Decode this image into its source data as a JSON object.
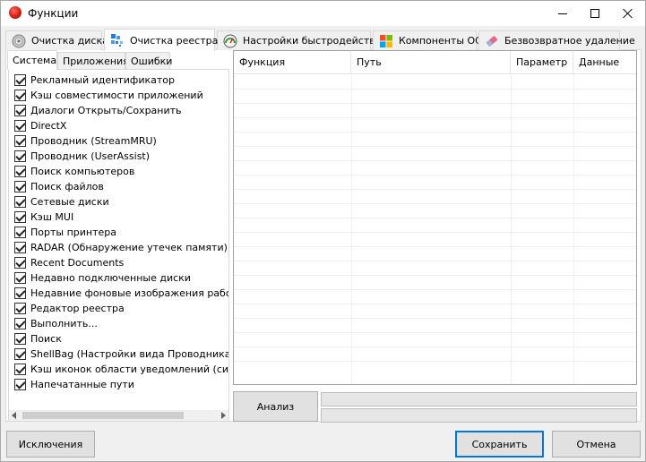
{
  "window": {
    "title": "Функции"
  },
  "tabs": [
    {
      "label": "Очистка диска",
      "icon": "disk-cleanup-icon"
    },
    {
      "label": "Очистка реестра",
      "icon": "registry-cleanup-icon",
      "active": true
    },
    {
      "label": "Настройки быстродействия",
      "icon": "speedometer-icon"
    },
    {
      "label": "Компоненты ОС",
      "icon": "windows-logo-icon"
    },
    {
      "label": "Безвозвратное удаление",
      "icon": "eraser-icon"
    }
  ],
  "subtabs": [
    {
      "label": "Система",
      "active": true
    },
    {
      "label": "Приложения"
    },
    {
      "label": "Ошибки"
    }
  ],
  "checklist": [
    {
      "label": "Рекламный идентификатор",
      "checked": true
    },
    {
      "label": "Кэш совместимости приложений",
      "checked": true
    },
    {
      "label": "Диалоги Открыть/Сохранить",
      "checked": true
    },
    {
      "label": "DirectX",
      "checked": true
    },
    {
      "label": "Проводник (StreamMRU)",
      "checked": true
    },
    {
      "label": "Проводник (UserAssist)",
      "checked": true
    },
    {
      "label": "Поиск компьютеров",
      "checked": true
    },
    {
      "label": "Поиск файлов",
      "checked": true
    },
    {
      "label": "Сетевые диски",
      "checked": true
    },
    {
      "label": "Кэш MUI",
      "checked": true
    },
    {
      "label": "Порты принтера",
      "checked": true
    },
    {
      "label": "RADAR (Обнаружение утечек памяти)",
      "checked": true
    },
    {
      "label": "Recent Documents",
      "checked": true
    },
    {
      "label": "Недавно подключенные диски",
      "checked": true
    },
    {
      "label": "Недавние фоновые изображения рабочего",
      "checked": true
    },
    {
      "label": "Редактор реестра",
      "checked": true
    },
    {
      "label": "Выполнить...",
      "checked": true
    },
    {
      "label": "Поиск",
      "checked": true
    },
    {
      "label": "ShellBag (Настройки вида Проводника)",
      "checked": true
    },
    {
      "label": "Кэш иконок области уведомлений (системн",
      "checked": true
    },
    {
      "label": "Напечатанные пути",
      "checked": true
    }
  ],
  "results_table": {
    "columns": [
      "Функция",
      "Путь",
      "Параметр",
      "Данные"
    ],
    "rows": []
  },
  "buttons": {
    "analyze": "Анализ",
    "exclusions": "Исключения",
    "save": "Сохранить",
    "cancel": "Отмена"
  },
  "accent_color": "#0078d7"
}
